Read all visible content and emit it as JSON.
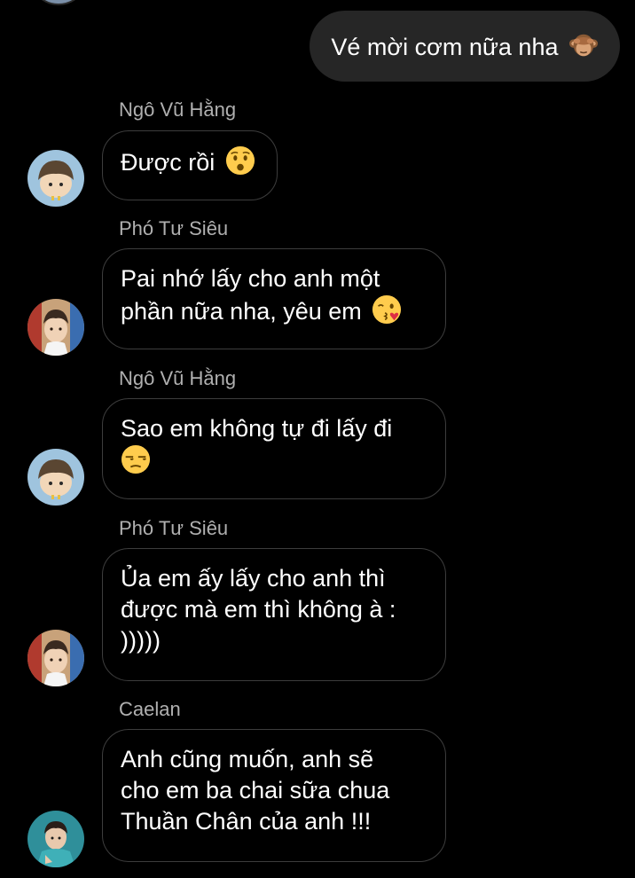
{
  "outgoing": {
    "text": "Vé mời cơm nữa nha",
    "emoji": "see-no-evil-monkey"
  },
  "messages": [
    {
      "sender": "Ngô Vũ Hằng",
      "lines": [
        "Được rồi"
      ],
      "emoji": "worried-face",
      "avatar": "avatar-ngo-vu-hang"
    },
    {
      "sender": "Phó Tư Siêu",
      "lines": [
        "Pai nhớ lấy cho anh một",
        "phần nữa nha, yêu em"
      ],
      "emoji": "face-blowing-kiss",
      "avatar": "avatar-pho-tu-sieu"
    },
    {
      "sender": "Ngô Vũ Hằng",
      "lines": [
        "Sao em không tự đi lấy đi"
      ],
      "emoji": "unamused-face",
      "avatar": "avatar-ngo-vu-hang"
    },
    {
      "sender": "Phó Tư Siêu",
      "lines": [
        "Ủa em ấy lấy cho anh thì",
        "được mà em thì không à :",
        ")))))"
      ],
      "emoji": null,
      "avatar": "avatar-pho-tu-sieu"
    },
    {
      "sender": "Caelan",
      "lines": [
        "Anh cũng muốn, anh sẽ",
        "cho em ba chai sữa chua",
        "Thuần Chân của anh !!!"
      ],
      "emoji": null,
      "avatar": "avatar-caelan"
    }
  ],
  "colors": {
    "background": "#000000",
    "outgoing_bubble": "#262626",
    "incoming_border": "#3d3d3d",
    "sender_name": "#b0b0b0",
    "text": "#ffffff"
  }
}
